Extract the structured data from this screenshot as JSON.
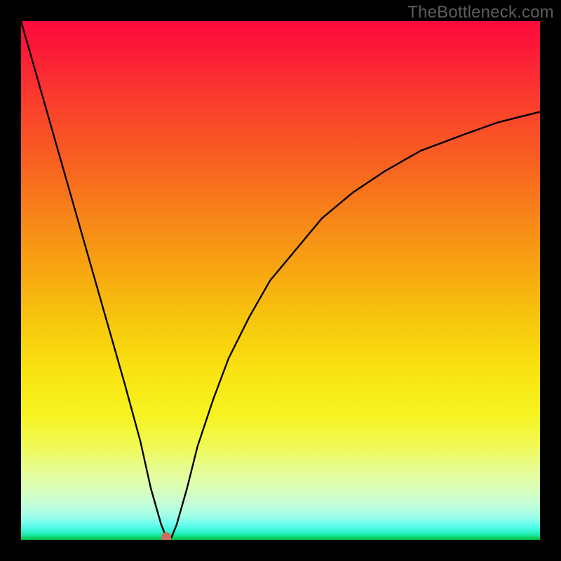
{
  "watermark": "TheBottleneck.com",
  "colors": {
    "frame_bg": "#000000",
    "curve_stroke": "#000000",
    "dot_fill": "#cc6b5e",
    "watermark_color": "#5c5c5c"
  },
  "chart_data": {
    "type": "line",
    "title": "",
    "xlabel": "",
    "ylabel": "",
    "xlim": [
      0,
      100
    ],
    "ylim": [
      0,
      100
    ],
    "annotations": [
      {
        "name": "marker-dot",
        "x": 28,
        "y": 0.5
      }
    ],
    "series": [
      {
        "name": "bottleneck-curve",
        "x": [
          0,
          4,
          8,
          12,
          16,
          20,
          23,
          25,
          27,
          28,
          29,
          30,
          32,
          34,
          37,
          40,
          44,
          48,
          53,
          58,
          64,
          70,
          77,
          85,
          92,
          100
        ],
        "y": [
          100,
          86,
          72,
          58,
          44,
          30,
          19,
          10,
          3,
          0.5,
          0.5,
          3,
          10,
          18,
          27,
          35,
          43,
          50,
          56,
          62,
          67,
          71,
          75,
          78,
          80.5,
          82.5
        ]
      }
    ],
    "background_gradient_stops": [
      {
        "pos": 0.0,
        "color": "#fd0b3b"
      },
      {
        "pos": 0.05,
        "color": "#fc1838"
      },
      {
        "pos": 0.15,
        "color": "#fa3c2d"
      },
      {
        "pos": 0.27,
        "color": "#f86021"
      },
      {
        "pos": 0.38,
        "color": "#f78618"
      },
      {
        "pos": 0.48,
        "color": "#f7a611"
      },
      {
        "pos": 0.58,
        "color": "#f7c70e"
      },
      {
        "pos": 0.67,
        "color": "#f8e20f"
      },
      {
        "pos": 0.76,
        "color": "#f6f321"
      },
      {
        "pos": 0.82,
        "color": "#f1fa56"
      },
      {
        "pos": 0.86,
        "color": "#e8fc8d"
      },
      {
        "pos": 0.9,
        "color": "#dbfdb8"
      },
      {
        "pos": 0.93,
        "color": "#c4fed7"
      },
      {
        "pos": 0.955,
        "color": "#9dfee9"
      },
      {
        "pos": 0.97,
        "color": "#6afdee"
      },
      {
        "pos": 0.982,
        "color": "#39f7d6"
      },
      {
        "pos": 0.99,
        "color": "#1bebab"
      },
      {
        "pos": 0.996,
        "color": "#0bcf65"
      },
      {
        "pos": 1.0,
        "color": "#05b338"
      }
    ]
  }
}
